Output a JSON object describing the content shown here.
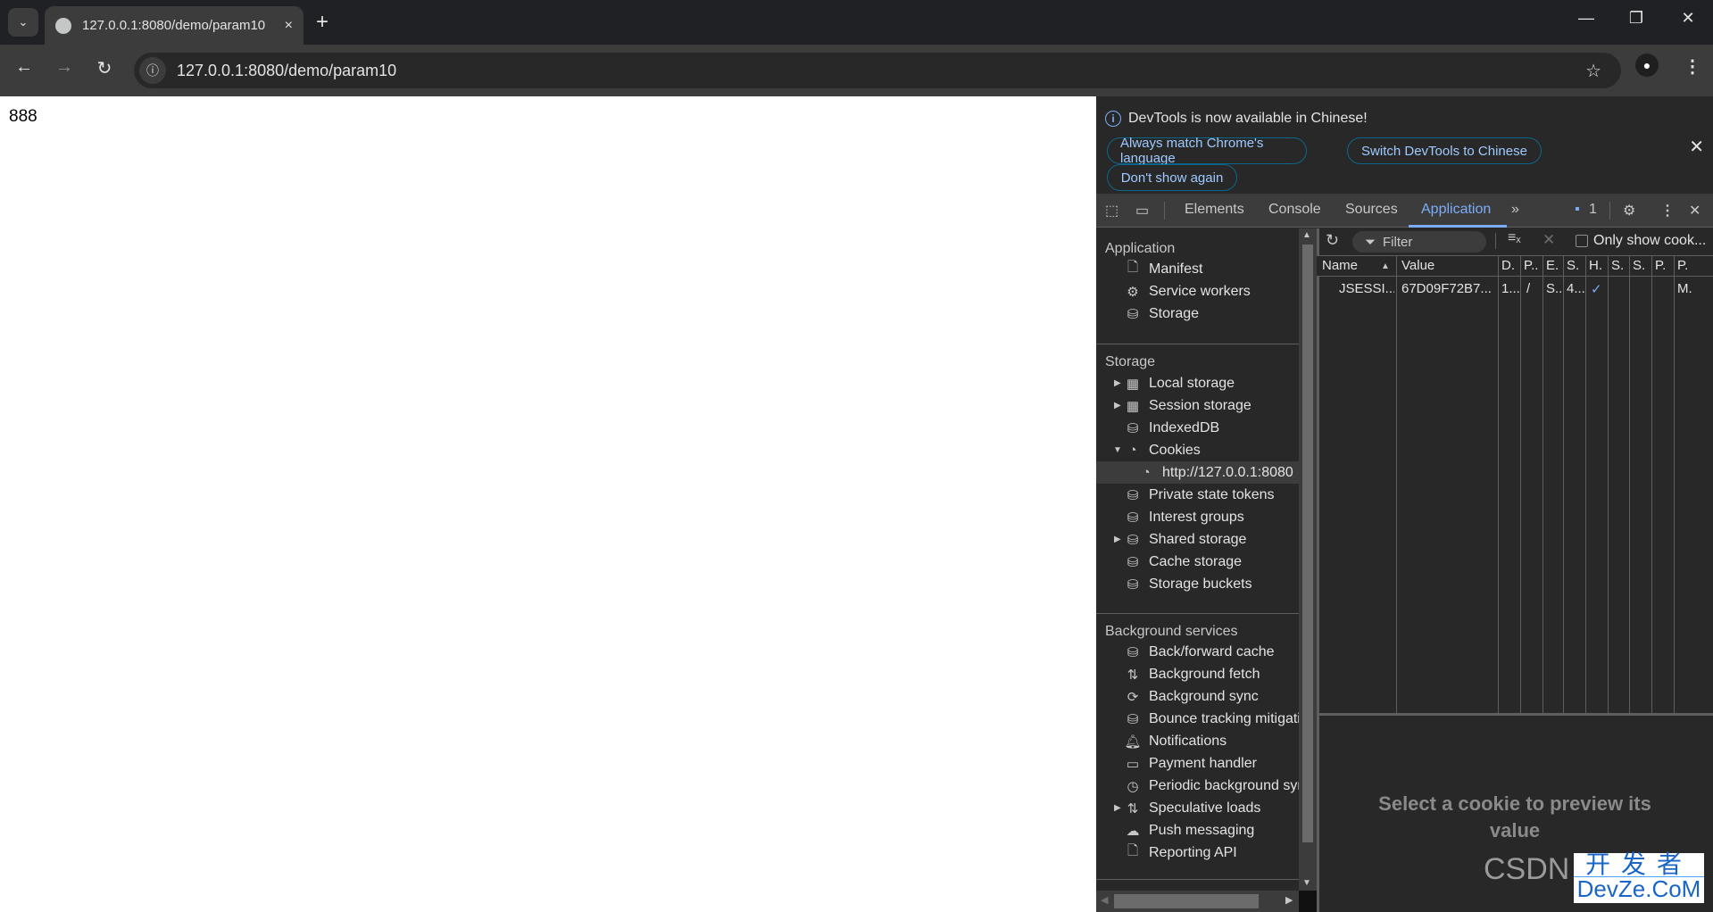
{
  "browser": {
    "tab": {
      "title": "127.0.0.1:8080/demo/param10",
      "close_icon": "×"
    },
    "new_tab_icon": "+",
    "tab_search_icon": "⌄",
    "window_controls": {
      "minimize": "—",
      "restore": "❐",
      "close": "✕"
    },
    "nav": {
      "back": "←",
      "forward": "→",
      "reload": "↻"
    },
    "omnibox": {
      "url": "127.0.0.1:8080/demo/param10",
      "info_icon": "ⓘ",
      "star_icon": "☆"
    },
    "profile_icon": "👤",
    "menu_icon": "⋮"
  },
  "page": {
    "content": "888"
  },
  "devtools": {
    "banner": {
      "message": "DevTools is now available in Chinese!",
      "buttons": [
        "Always match Chrome's language",
        "Switch DevTools to Chinese",
        "Don't show again"
      ],
      "close_icon": "✕"
    },
    "tabs": [
      "Elements",
      "Console",
      "Sources",
      "Application"
    ],
    "active_tab": "Application",
    "more_tabs_icon": "»",
    "issues_count": "1",
    "accent": "#7cacf8",
    "sidebar": {
      "sections": [
        {
          "title": "Application",
          "items": [
            {
              "label": "Manifest",
              "icon": "file-icon"
            },
            {
              "label": "Service workers",
              "icon": "gears-icon"
            },
            {
              "label": "Storage",
              "icon": "database-icon"
            }
          ]
        },
        {
          "title": "Storage",
          "items": [
            {
              "label": "Local storage",
              "icon": "table-icon",
              "expander": "collapsed"
            },
            {
              "label": "Session storage",
              "icon": "table-icon",
              "expander": "collapsed"
            },
            {
              "label": "IndexedDB",
              "icon": "database-icon"
            },
            {
              "label": "Cookies",
              "icon": "cookie-icon",
              "expander": "expanded"
            },
            {
              "label": "http://127.0.0.1:8080",
              "icon": "cookie-icon",
              "child": true,
              "selected": true
            },
            {
              "label": "Private state tokens",
              "icon": "database-icon"
            },
            {
              "label": "Interest groups",
              "icon": "database-icon"
            },
            {
              "label": "Shared storage",
              "icon": "database-icon",
              "expander": "collapsed"
            },
            {
              "label": "Cache storage",
              "icon": "database-icon"
            },
            {
              "label": "Storage buckets",
              "icon": "database-icon"
            }
          ]
        },
        {
          "title": "Background services",
          "items": [
            {
              "label": "Back/forward cache",
              "icon": "database-icon"
            },
            {
              "label": "Background fetch",
              "icon": "arrows-updown-icon"
            },
            {
              "label": "Background sync",
              "icon": "sync-icon"
            },
            {
              "label": "Bounce tracking mitigations",
              "icon": "database-icon"
            },
            {
              "label": "Notifications",
              "icon": "bell-icon"
            },
            {
              "label": "Payment handler",
              "icon": "card-icon"
            },
            {
              "label": "Periodic background sync",
              "icon": "clock-icon"
            },
            {
              "label": "Speculative loads",
              "icon": "arrows-updown-icon",
              "expander": "collapsed"
            },
            {
              "label": "Push messaging",
              "icon": "cloud-icon"
            },
            {
              "label": "Reporting API",
              "icon": "file-icon"
            }
          ]
        }
      ]
    },
    "cookies": {
      "filter_placeholder": "Filter",
      "only_show_label": "Only show cook...",
      "columns": [
        "Name",
        "Value",
        "D.",
        "P..",
        "E.",
        "S.",
        "H.",
        "S.",
        "S.",
        "P.",
        "P."
      ],
      "sort_indicator": "▲",
      "rows": [
        [
          "JSESSI...",
          "67D09F72B7...",
          "1...",
          "/",
          "S..",
          "4...",
          "✓",
          "",
          "",
          "",
          "M."
        ]
      ],
      "preview_text": "Select a cookie to preview its value"
    }
  },
  "watermark": {
    "left": "CSDN",
    "cn": "开发者",
    "en": "DevZe.CoM"
  }
}
